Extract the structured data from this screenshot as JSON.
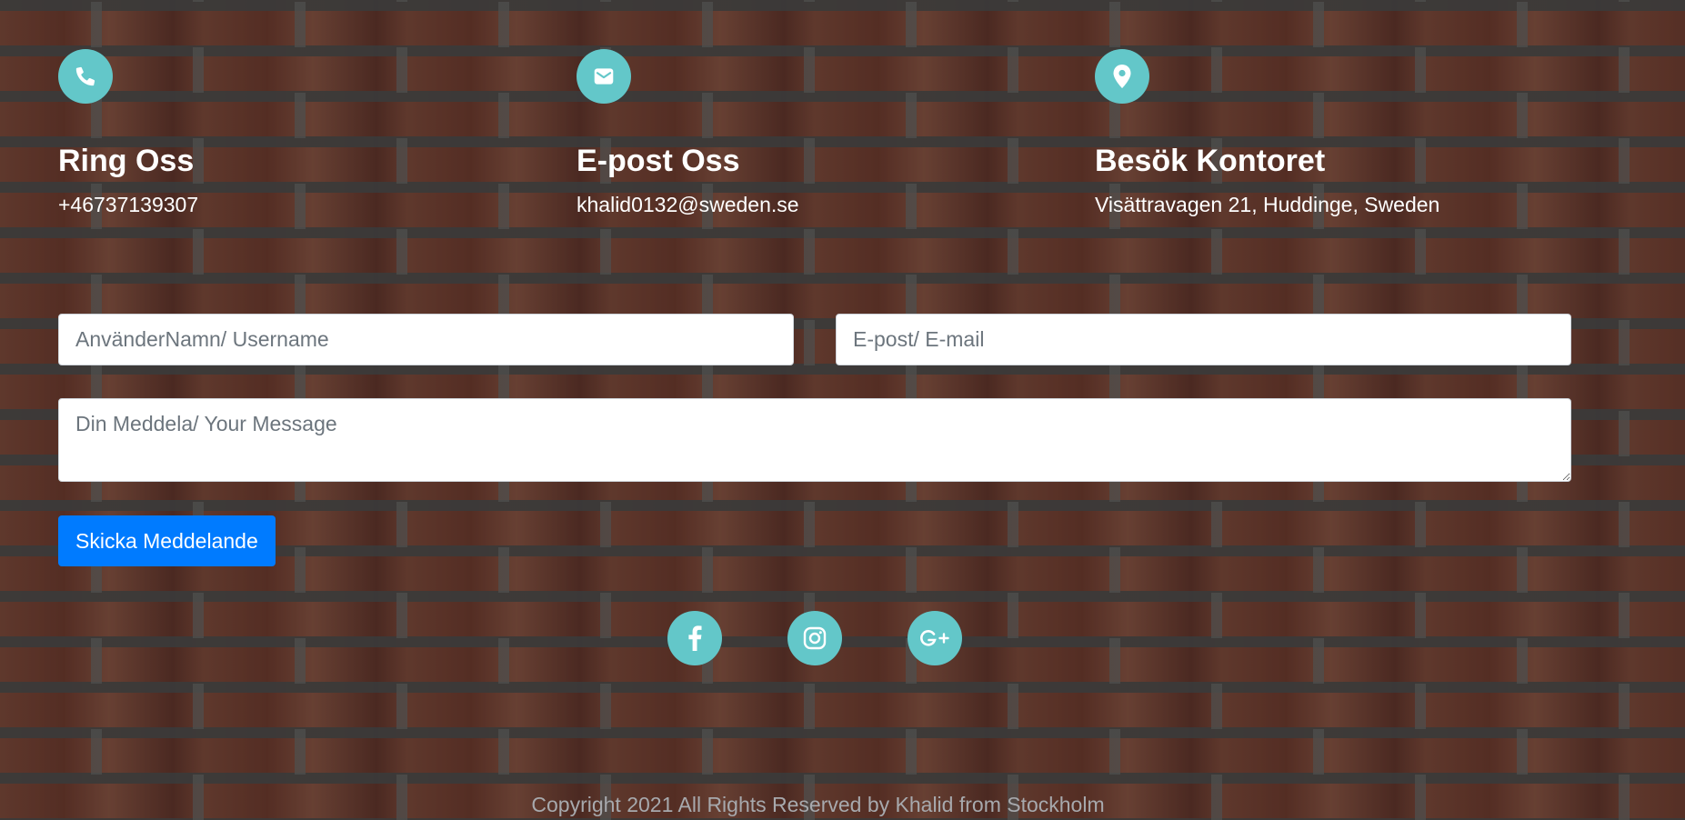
{
  "colors": {
    "accent": "#63c7c9",
    "primary_button": "#007bff",
    "text": "#ffffff",
    "footer_text": "#a7a9ad"
  },
  "contact": {
    "phone": {
      "icon": "phone-icon",
      "title": "Ring Oss",
      "value": "+46737139307"
    },
    "email": {
      "icon": "envelope-icon",
      "title": "E-post Oss",
      "value": "khalid0132@sweden.se"
    },
    "office": {
      "icon": "map-marker-icon",
      "title": "Besök Kontoret",
      "value": "Visättravagen 21, Huddinge, Sweden"
    }
  },
  "form": {
    "username_placeholder": "AnvänderNamn/ Username",
    "email_placeholder": "E-post/ E-mail",
    "message_placeholder": "Din Meddela/ Your Message",
    "submit_label": "Skicka Meddelande"
  },
  "social": [
    {
      "icon": "facebook-icon"
    },
    {
      "icon": "instagram-icon"
    },
    {
      "icon": "google-plus-icon"
    }
  ],
  "footer": {
    "copyright": "Copyright 2021 All Rights Reserved by Khalid from Stockholm"
  }
}
